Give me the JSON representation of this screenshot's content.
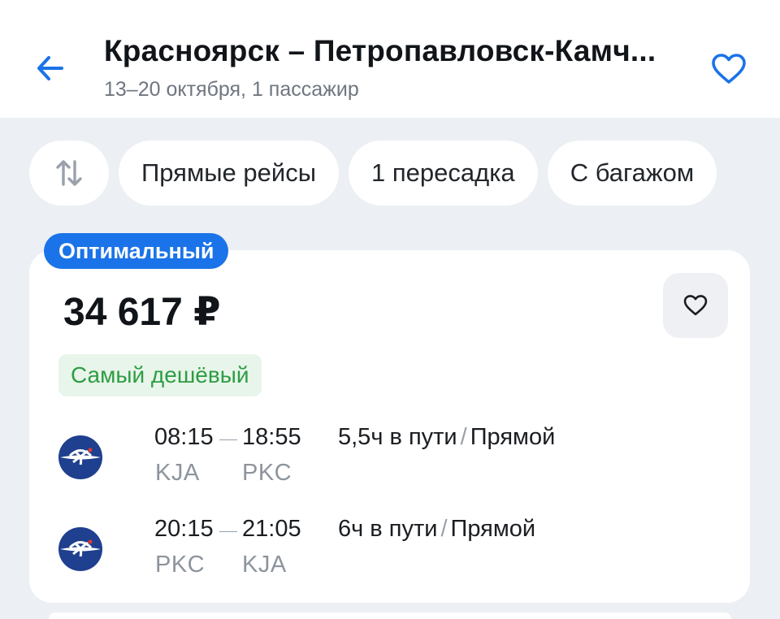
{
  "header": {
    "title": "Красноярск – Петропавловск-Камч...",
    "subtitle": "13–20 октября, 1 пассажир",
    "accent_color": "#1a73e8",
    "back_icon": "arrow-left-icon",
    "fav_icon": "heart-outline-icon"
  },
  "filters": {
    "sort_icon": "sort-arrows-icon",
    "chips": [
      "Прямые рейсы",
      "1 пересадка",
      "С багажом"
    ]
  },
  "offer": {
    "badge": "Оптимальный",
    "price": "34 617 ₽",
    "tag": "Самый дешёвый",
    "fav_icon": "heart-outline-icon",
    "segments": [
      {
        "depart_time": "08:15",
        "arrive_time": "18:55",
        "from": "KJA",
        "to": "PKC",
        "duration": "5,5ч в пути",
        "separator": "/",
        "type": "Прямой",
        "airline_icon": "aeroflot-logo-icon"
      },
      {
        "depart_time": "20:15",
        "arrive_time": "21:05",
        "from": "PKC",
        "to": "KJA",
        "duration": "6ч в пути",
        "separator": "/",
        "type": "Прямой",
        "airline_icon": "aeroflot-logo-icon"
      }
    ]
  }
}
